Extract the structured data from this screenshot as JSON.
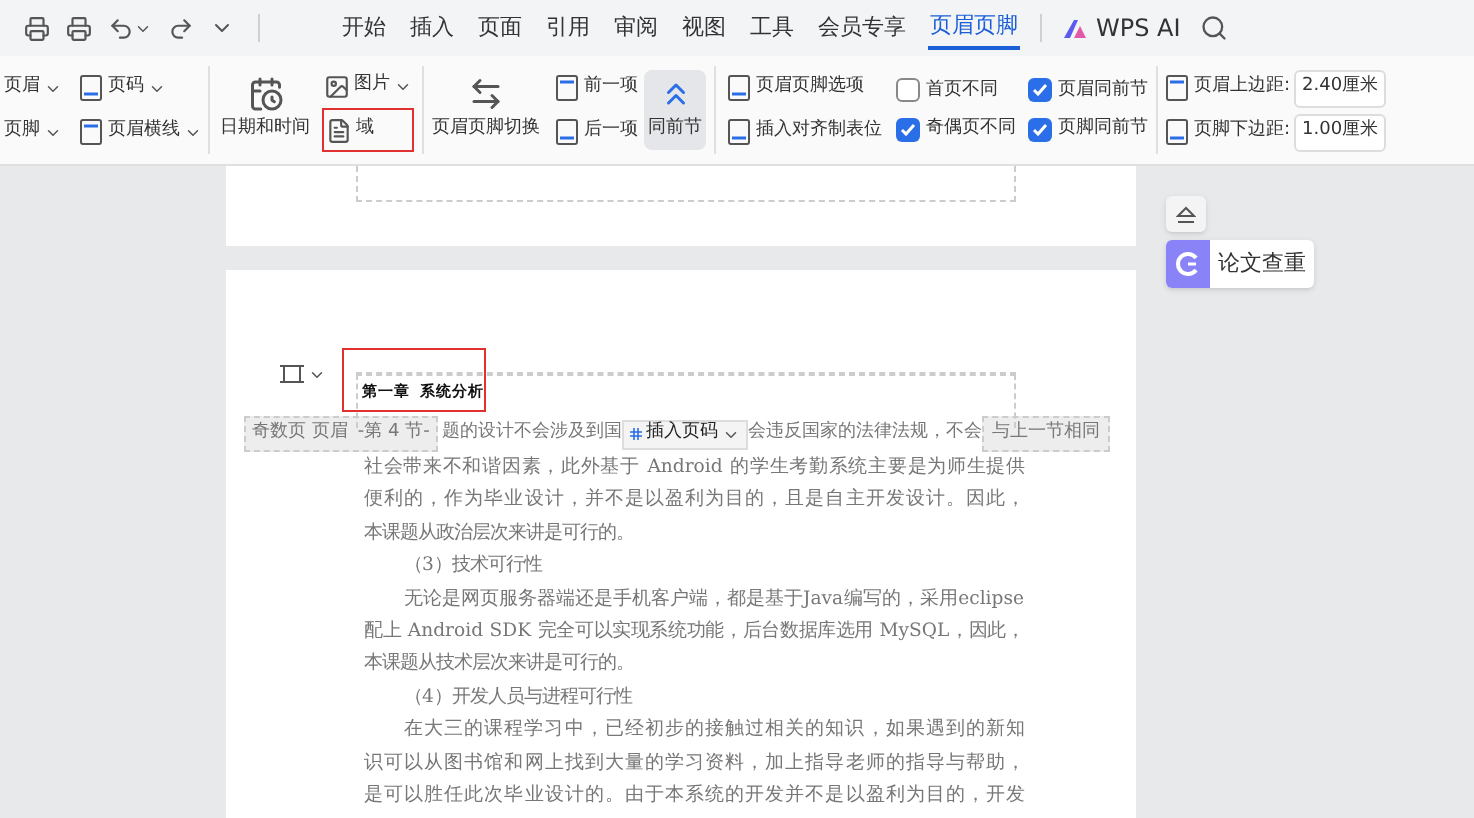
{
  "tabs": [
    {
      "label": "开始",
      "selected": false
    },
    {
      "label": "插入",
      "selected": false
    },
    {
      "label": "页面",
      "selected": false
    },
    {
      "label": "引用",
      "selected": false
    },
    {
      "label": "审阅",
      "selected": false
    },
    {
      "label": "视图",
      "selected": false
    },
    {
      "label": "工具",
      "selected": false
    },
    {
      "label": "会员专享",
      "selected": false
    },
    {
      "label": "页眉页脚",
      "selected": true
    }
  ],
  "ai_label": "WPS AI",
  "ribbon": {
    "header": "页眉",
    "page_number": "页码",
    "footer": "页脚",
    "header_line": "页眉横线",
    "date_time": "日期和时间",
    "picture": "图片",
    "field": {
      "label": "域",
      "highlighted": true
    },
    "switch": "页眉页脚切换",
    "previous": "前一项",
    "next": "后一项",
    "link_previous": {
      "label": "同前节",
      "selected": true
    },
    "options": "页眉页脚选项",
    "insert_tab": "插入对齐制表位",
    "checkboxes": [
      {
        "label": "首页不同",
        "checked": false
      },
      {
        "label": "奇偶页不同",
        "checked": true
      },
      {
        "label": "页眉同前节",
        "checked": true
      },
      {
        "label": "页脚同前节",
        "checked": true
      }
    ],
    "margins": [
      {
        "label": "页眉上边距:",
        "value": "2.40厘米"
      },
      {
        "label": "页脚下边距:",
        "value": "1.00厘米"
      }
    ]
  },
  "document": {
    "header_text": {
      "text": "第一章  系统分析",
      "highlighted": true
    },
    "header_label": "奇数页 页眉",
    "section": "-第 4 节-",
    "insert_page_number": "插入页码",
    "same_as_previous": "与上一节相同",
    "first_line_parts": [
      "题的设计不会涉及到国",
      "会违反国家的法律法规，不会"
    ],
    "lines": [
      {
        "kind": "line",
        "text": "社会带来不和谐因素，此外基于 Android 的学生考勤系统主要是为师生提供"
      },
      {
        "kind": "line",
        "text": "便利的，作为毕业设计，并不是以盈利为目的，且是自主开发设计。因此，"
      },
      {
        "kind": "end",
        "text": "本课题从政治层次来讲是可行的。"
      },
      {
        "kind": "heading",
        "text": "（3）技术可行性"
      },
      {
        "kind": "indent",
        "text": "无论是网页服务器端还是手机客户端，都是基于Java编写的，采用eclipse"
      },
      {
        "kind": "line",
        "text": "配上 Android SDK 完全可以实现系统功能，后台数据库选用 MySQL，因此，"
      },
      {
        "kind": "end",
        "text": "本课题从技术层次来讲是可行的。"
      },
      {
        "kind": "heading",
        "text": "（4）开发人员与进程可行性"
      },
      {
        "kind": "indent",
        "text": "在大三的课程学习中，已经初步的接触过相关的知识，如果遇到的新知"
      },
      {
        "kind": "line",
        "text": "识可以从图书馆和网上找到大量的学习资料，加上指导老师的指导与帮助，"
      },
      {
        "kind": "line",
        "text": "是可以胜任此次毕业设计的。由于本系统的开发并不是以盈利为目的，开发"
      }
    ]
  },
  "side_panel": {
    "check_label": "论文查重"
  }
}
